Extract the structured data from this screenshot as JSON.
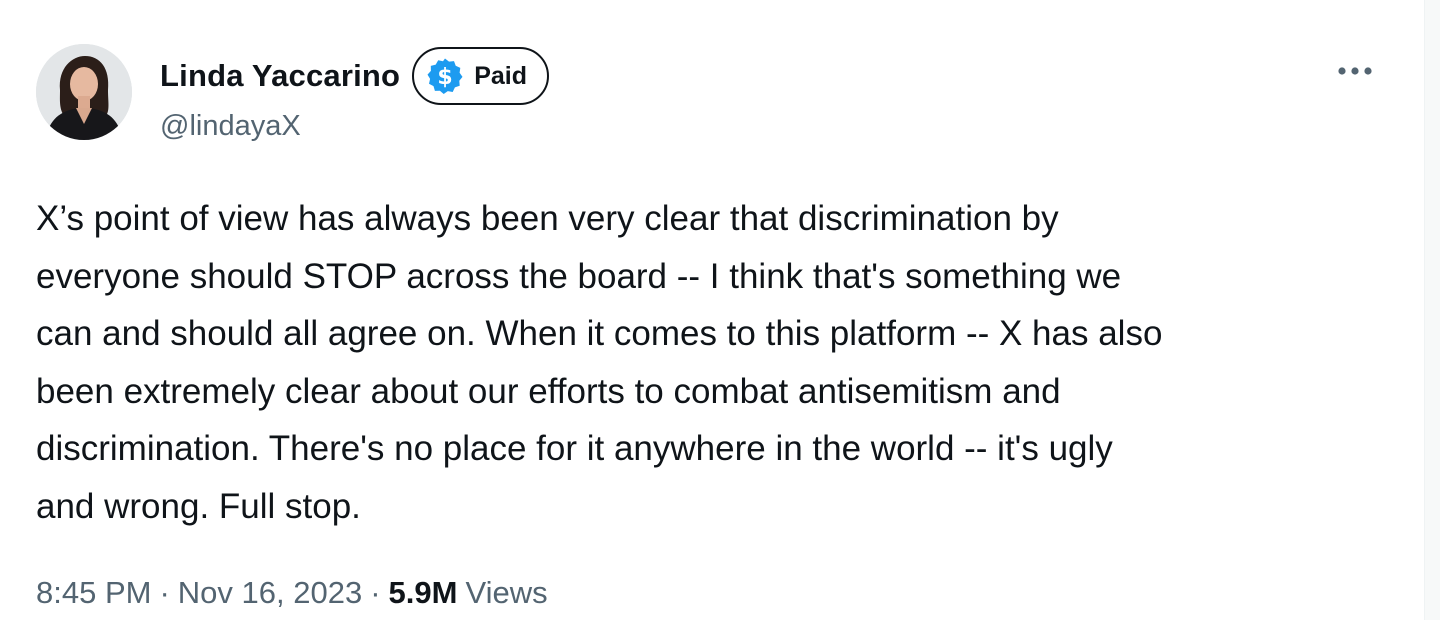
{
  "tweet": {
    "author": {
      "display_name": "Linda Yaccarino",
      "handle": "@lindayaX",
      "badge": {
        "label": "Paid",
        "icon": "dollar-icon",
        "icon_color": "#1d9bf0"
      },
      "avatar_icon": "profile-photo"
    },
    "more_icon": "more-horizontal-icon",
    "text": "X’s point of view has always been very clear that discrimination by\neveryone should STOP across the board -- I think that's something we\ncan and should all agree on. When it comes to this platform -- X has also\nbeen extremely clear about our efforts to combat antisemitism and\ndiscrimination. There's no place for it anywhere in the world -- it's ugly\nand wrong. Full stop.",
    "meta": {
      "time": "8:45 PM",
      "separator": "·",
      "date": "Nov 16, 2023",
      "views_count": "5.9M",
      "views_label": "Views"
    }
  },
  "colors": {
    "text_primary": "#0f1419",
    "text_secondary": "#536471",
    "accent": "#1d9bf0",
    "background": "#ffffff"
  }
}
